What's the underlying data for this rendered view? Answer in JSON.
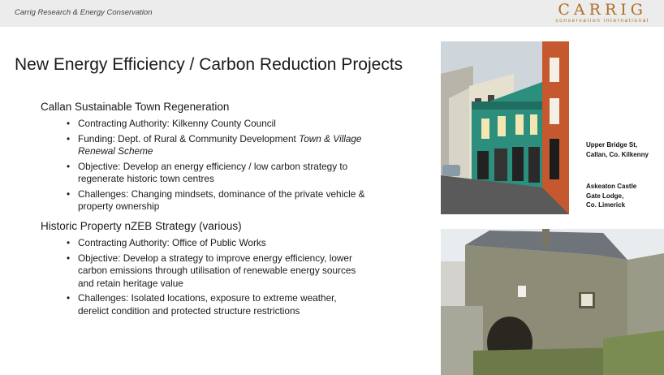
{
  "header": {
    "company": "Carrig Research & Energy Conservation",
    "logo_name": "CARRIG",
    "logo_sub": "conservation international"
  },
  "title": "New Energy Efficiency / Carbon Reduction Projects",
  "sections": [
    {
      "heading": "Callan Sustainable Town Regeneration",
      "bullets": [
        {
          "text": "Contracting Authority: Kilkenny County Council"
        },
        {
          "text": "Funding: Dept. of Rural & Community Development ",
          "emph": "Town & Village Renewal Scheme"
        },
        {
          "text": "Objective: Develop an energy efficiency / low carbon strategy to regenerate historic town centres"
        },
        {
          "text": "Challenges: Changing mindsets, dominance of the private vehicle & property ownership"
        }
      ]
    },
    {
      "heading": "Historic Property nZEB Strategy (various)",
      "bullets": [
        {
          "text": "Contracting Authority: Office of Public Works"
        },
        {
          "text": "Objective: Develop a strategy to improve energy efficiency, lower carbon emissions through utilisation of renewable energy sources and retain heritage value"
        },
        {
          "text": "Challenges: Isolated locations, exposure to extreme weather, derelict condition and protected structure restrictions"
        }
      ]
    }
  ],
  "captions": {
    "photo1": [
      "Upper Bridge St,",
      "Callan, Co. Kilkenny"
    ],
    "photo2": [
      "Askeaton Castle",
      "Gate Lodge,",
      "Co. Limerick"
    ]
  },
  "colors": {
    "brand": "#b06e22",
    "topbar": "#ececec"
  }
}
